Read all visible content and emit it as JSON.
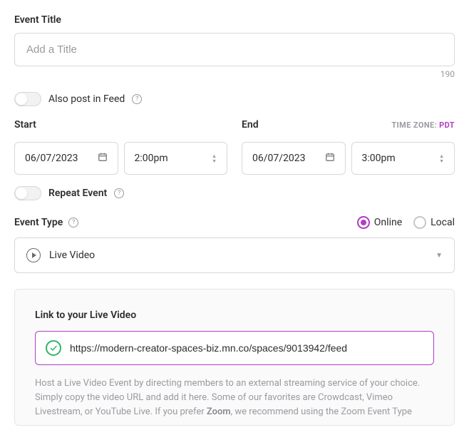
{
  "title_section": {
    "label": "Event Title",
    "placeholder": "Add a Title",
    "value": "",
    "char_remaining": "190"
  },
  "feed_toggle": {
    "label": "Also post in Feed"
  },
  "timezone": {
    "label": "TIME ZONE:",
    "value": "PDT"
  },
  "start": {
    "label": "Start",
    "date": "06/07/2023",
    "time": "2:00pm"
  },
  "end": {
    "label": "End",
    "date": "06/07/2023",
    "time": "3:00pm"
  },
  "repeat_toggle": {
    "label": "Repeat Event"
  },
  "event_type": {
    "label": "Event Type",
    "options": {
      "online": "Online",
      "local": "Local"
    },
    "selected": "online",
    "dropdown_value": "Live Video"
  },
  "live_video": {
    "label": "Link to your Live Video",
    "value": "https://modern-creator-spaces-biz.mn.co/spaces/9013942/feed",
    "help_pre": "Host a Live Video Event by directing members to an external streaming service of your choice. Simply copy the video URL and add it here. Some of our favorites are Crowdcast, Vimeo Livestream, or YouTube Live. If you prefer ",
    "help_bold": "Zoom",
    "help_post": ", we recommend using the Zoom Event Type"
  }
}
